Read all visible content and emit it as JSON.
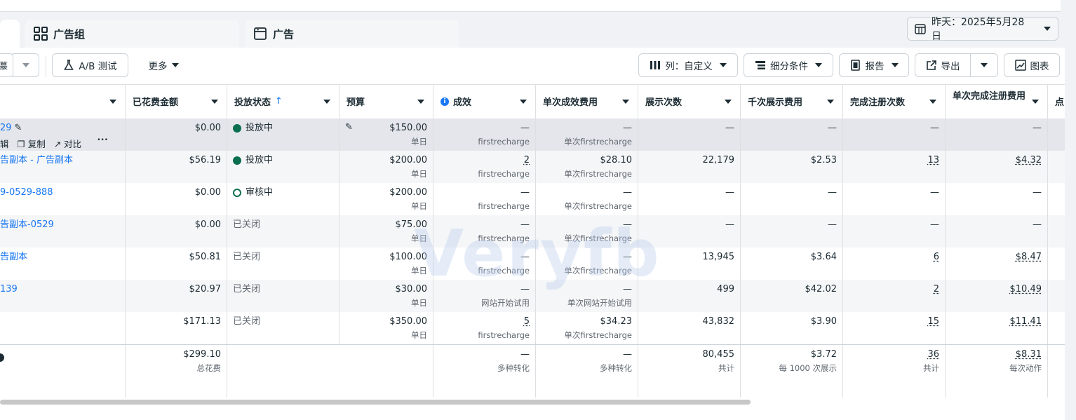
{
  "tabs": {
    "adset": "广告组",
    "ad": "广告"
  },
  "date_range": "昨天：2025年5月28日",
  "toolbar": {
    "ab_test": "A/B 测试",
    "more": "更多",
    "columns": "列：自定义",
    "breakdown": "细分条件",
    "report": "报告",
    "export": "导出",
    "chart": "图表"
  },
  "columns": {
    "spent": "已花费金额",
    "status": "投放状态",
    "budget": "预算",
    "results": "成效",
    "cost_per_result": "单次成效费用",
    "impressions": "展示次数",
    "cpm": "千次展示费用",
    "registrations": "完成注册次数",
    "cost_per_registration": "单次完成注册费用",
    "last": "点"
  },
  "rows": [
    {
      "name": "29",
      "actions": [
        "辑",
        "复制",
        "对比"
      ],
      "spent": "$0.00",
      "status": "投放中",
      "status_type": "on",
      "budget": "$150.00",
      "budget_sub": "单日",
      "results": "—",
      "results_sub": "firstrecharge",
      "cpr": "—",
      "cpr_sub": "单次firstrecharge",
      "impr": "—",
      "cpm": "—",
      "reg": "—",
      "cpreg": "—"
    },
    {
      "name": "告副本 - 广告副本",
      "spent": "$56.19",
      "status": "投放中",
      "status_type": "on",
      "budget": "$200.00",
      "budget_sub": "单日",
      "results": "2",
      "results_sub": "firstrecharge",
      "cpr": "$28.10",
      "cpr_sub": "单次firstrecharge",
      "impr": "22,179",
      "cpm": "$2.53",
      "reg": "13",
      "cpreg": "$4.32"
    },
    {
      "name": "9-0529-888",
      "spent": "$0.00",
      "status": "审核中",
      "status_type": "rev",
      "budget": "$200.00",
      "budget_sub": "单日",
      "results": "—",
      "results_sub": "firstrecharge",
      "cpr": "—",
      "cpr_sub": "单次firstrecharge",
      "impr": "—",
      "cpm": "—",
      "reg": "—",
      "cpreg": "—"
    },
    {
      "name": "告副本-0529",
      "spent": "$0.00",
      "status": "已关闭",
      "status_type": "off",
      "budget": "$75.00",
      "budget_sub": "单日",
      "results": "—",
      "results_sub": "firstrecharge",
      "cpr": "—",
      "cpr_sub": "单次firstrecharge",
      "impr": "—",
      "cpm": "—",
      "reg": "—",
      "cpreg": "—"
    },
    {
      "name": "告副本",
      "spent": "$50.81",
      "status": "已关闭",
      "status_type": "off",
      "budget": "$100.00",
      "budget_sub": "单日",
      "results": "—",
      "results_sub": "firstrecharge",
      "cpr": "—",
      "cpr_sub": "单次firstrecharge",
      "impr": "13,945",
      "cpm": "$3.64",
      "reg": "6",
      "cpreg": "$8.47"
    },
    {
      "name": "139",
      "spent": "$20.97",
      "status": "已关闭",
      "status_type": "off",
      "budget": "$30.00",
      "budget_sub": "单日",
      "results": "—",
      "results_sub": "网站开始试用",
      "cpr": "—",
      "cpr_sub": "单次网站开始试用",
      "impr": "499",
      "cpm": "$42.02",
      "reg": "2",
      "cpreg": "$10.49"
    },
    {
      "name": "",
      "spent": "$171.13",
      "status": "已关闭",
      "status_type": "off",
      "budget": "$350.00",
      "budget_sub": "单日",
      "results": "5",
      "results_sub": "firstrecharge",
      "cpr": "$34.23",
      "cpr_sub": "单次firstrecharge",
      "impr": "43,832",
      "cpm": "$3.90",
      "reg": "15",
      "cpreg": "$11.41"
    }
  ],
  "totals": {
    "spent": "$299.10",
    "spent_sub": "总花费",
    "results": "—",
    "results_sub": "多种转化",
    "cpr": "—",
    "cpr_sub": "多种转化",
    "impr": "80,455",
    "impr_sub": "共计",
    "cpm": "$3.72",
    "cpm_sub": "每 1000 次展示",
    "reg": "36",
    "reg_sub": "共计",
    "cpreg": "$8.31",
    "cpreg_sub": "每次动作"
  },
  "watermark": "Veryfb",
  "colors": {
    "link": "#1877f2",
    "active_dot": "#0a6e4f",
    "bg": "#f0f2f5"
  }
}
